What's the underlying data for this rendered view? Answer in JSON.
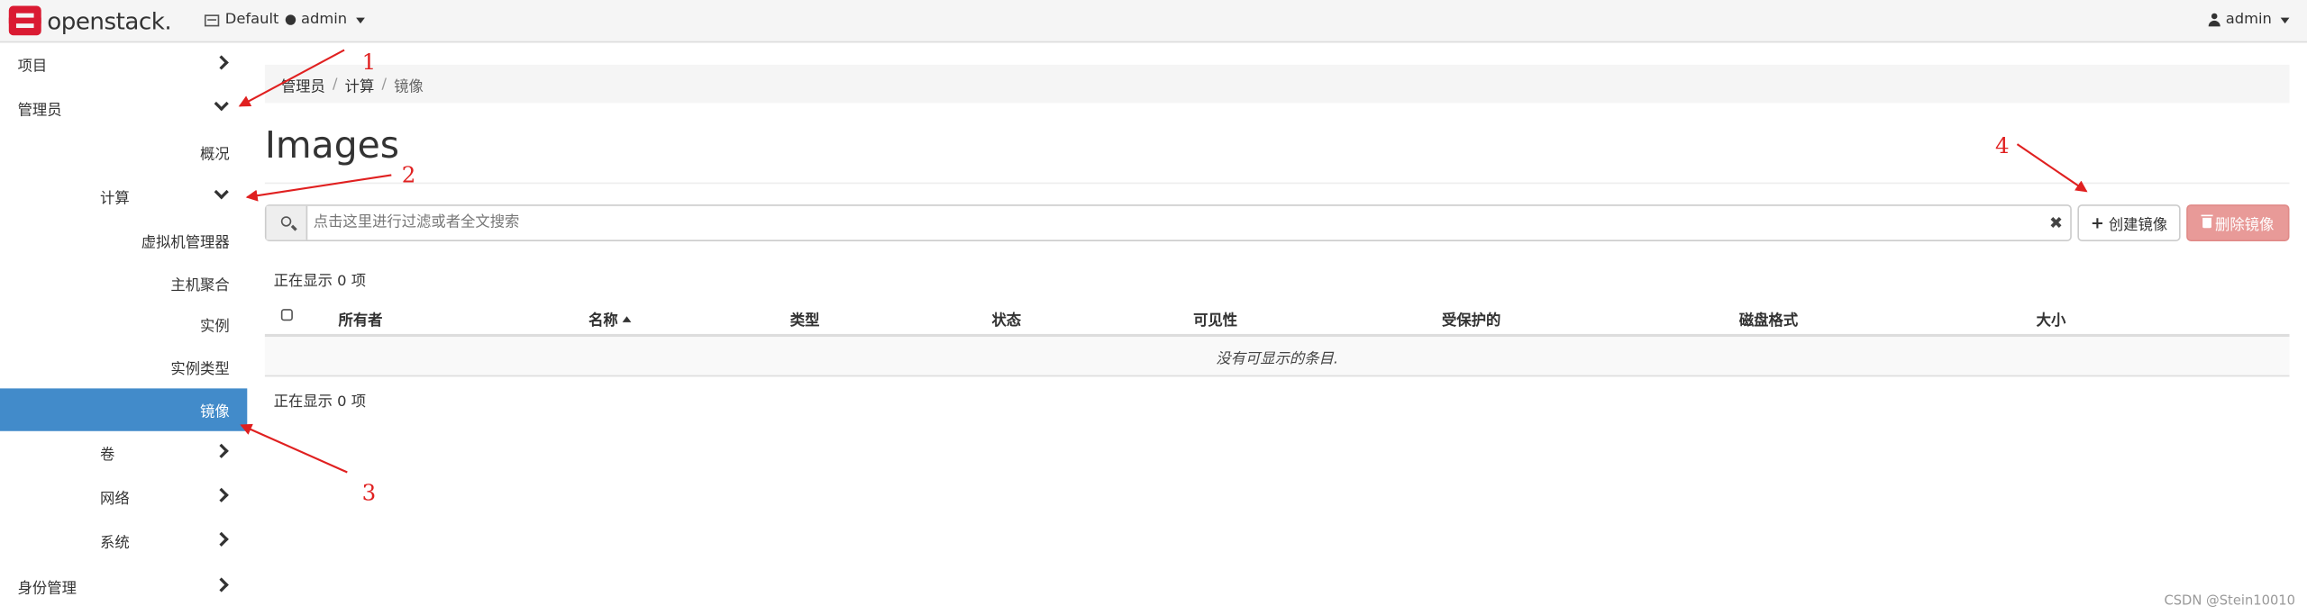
{
  "navbar": {
    "brand": "openstack",
    "brand_dot": ".",
    "project_domain": "Default",
    "project_name": "admin",
    "user": "admin"
  },
  "sidebar": {
    "items": [
      {
        "label": "项目",
        "level": 0,
        "state": "collapsed"
      },
      {
        "label": "管理员",
        "level": 0,
        "state": "expanded"
      },
      {
        "label": "概况",
        "level": 2
      },
      {
        "label": "计算",
        "level": 1,
        "state": "expanded"
      },
      {
        "label": "虚拟机管理器",
        "level": 2
      },
      {
        "label": "主机聚合",
        "level": 2
      },
      {
        "label": "实例",
        "level": 2
      },
      {
        "label": "实例类型",
        "level": 2
      },
      {
        "label": "镜像",
        "level": 2,
        "active": true
      },
      {
        "label": "卷",
        "level": 1,
        "state": "collapsed"
      },
      {
        "label": "网络",
        "level": 1,
        "state": "collapsed"
      },
      {
        "label": "系统",
        "level": 1,
        "state": "collapsed"
      },
      {
        "label": "身份管理",
        "level": 0,
        "state": "collapsed"
      }
    ],
    "active_color": "#428bca"
  },
  "breadcrumb": [
    "管理员",
    "计算",
    "镜像"
  ],
  "page": {
    "title": "Images",
    "filter_placeholder": "点击这里进行过滤或者全文搜索",
    "create_label": "创建镜像",
    "delete_label": "删除镜像",
    "count_top": "正在显示 0 项",
    "count_bottom": "正在显示 0 项"
  },
  "table": {
    "columns": [
      "所有者",
      "名称",
      "类型",
      "状态",
      "可见性",
      "受保护的",
      "磁盘格式",
      "大小"
    ],
    "sorted_column": "名称",
    "empty_text": "没有可显示的条目."
  },
  "annotations": {
    "labels": [
      "1",
      "2",
      "3",
      "4"
    ],
    "color": "#e02020"
  },
  "watermark": "CSDN @Stein10010"
}
